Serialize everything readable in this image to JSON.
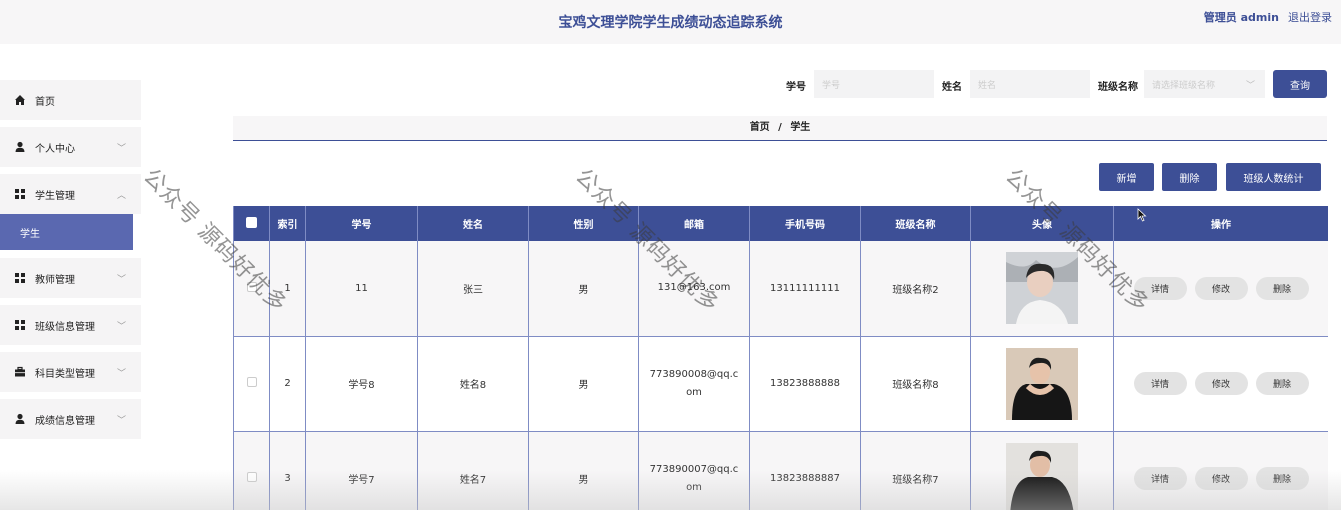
{
  "header": {
    "title": "宝鸡文理学院学生成绩动态追踪系统",
    "user": "管理员 admin",
    "logout": "退出登录"
  },
  "sidebar": {
    "items": [
      {
        "label": "首页",
        "icon": "home-icon"
      },
      {
        "label": "个人中心",
        "icon": "user-icon"
      },
      {
        "label": "学生管理",
        "icon": "grid-icon"
      },
      {
        "label": "教师管理",
        "icon": "grid-icon"
      },
      {
        "label": "班级信息管理",
        "icon": "grid-icon"
      },
      {
        "label": "科目类型管理",
        "icon": "briefcase-icon"
      },
      {
        "label": "成绩信息管理",
        "icon": "user-icon"
      }
    ],
    "active_sub": "学生"
  },
  "search": {
    "student_no_label": "学号",
    "student_no_placeholder": "学号",
    "name_label": "姓名",
    "name_placeholder": "姓名",
    "class_label": "班级名称",
    "class_placeholder": "请选择班级名称",
    "query_button": "查询"
  },
  "breadcrumb": {
    "home": "首页",
    "sep": "/",
    "current": "学生"
  },
  "actions": {
    "add": "新增",
    "delete": "删除",
    "stats": "班级人数统计"
  },
  "table": {
    "headers": [
      "索引",
      "学号",
      "姓名",
      "性别",
      "邮箱",
      "手机号码",
      "班级名称",
      "头像",
      "操作"
    ],
    "rows": [
      {
        "index": "1",
        "student_no": "11",
        "name": "张三",
        "gender": "男",
        "email": "131@163.com",
        "phone": "13111111111",
        "class_name": "班级名称2"
      },
      {
        "index": "2",
        "student_no": "学号8",
        "name": "姓名8",
        "gender": "男",
        "email": "773890008@qq.com",
        "phone": "13823888888",
        "class_name": "班级名称8"
      },
      {
        "index": "3",
        "student_no": "学号7",
        "name": "姓名7",
        "gender": "男",
        "email": "773890007@qq.com",
        "phone": "13823888887",
        "class_name": "班级名称7"
      }
    ],
    "ops": {
      "detail": "详情",
      "edit": "修改",
      "delete": "删除"
    }
  },
  "watermark": "公众号 源码好优多",
  "colors": {
    "primary": "#3d4f96",
    "sidebar_active": "#5a68b0"
  }
}
